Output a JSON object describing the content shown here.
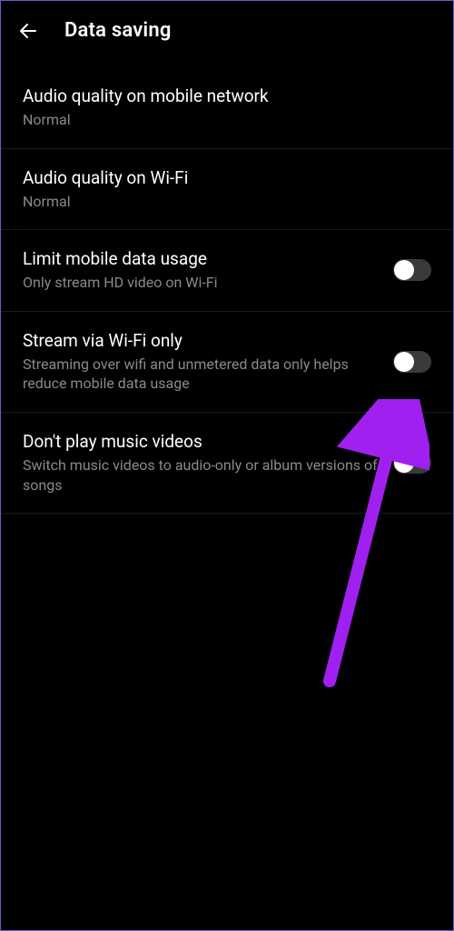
{
  "header": {
    "title": "Data saving"
  },
  "settings": [
    {
      "title": "Audio quality on mobile network",
      "subtitle": "Normal",
      "hasToggle": false
    },
    {
      "title": "Audio quality on Wi-Fi",
      "subtitle": "Normal",
      "hasToggle": false
    },
    {
      "title": "Limit mobile data usage",
      "subtitle": "Only stream HD video on Wi-Fi",
      "hasToggle": true,
      "toggleOn": false
    },
    {
      "title": "Stream via Wi-Fi only",
      "subtitle": "Streaming over wifi and unmetered data only helps reduce mobile data usage",
      "hasToggle": true,
      "toggleOn": false
    },
    {
      "title": "Don't play music videos",
      "subtitle": "Switch music videos to audio-only or album versions of songs",
      "hasToggle": true,
      "toggleOn": false
    }
  ],
  "annotation": {
    "arrowColor": "#a020f0"
  }
}
